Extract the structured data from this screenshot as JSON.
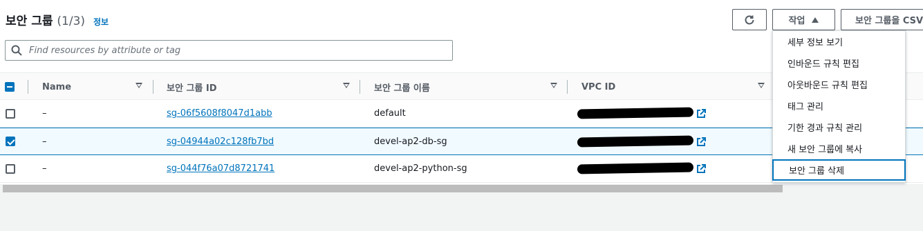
{
  "header": {
    "title": "보안 그룹",
    "count": "(1/3)",
    "info_link": "정보"
  },
  "toolbar": {
    "actions_label": "작업",
    "csv_label": "보안 그룹을 CSV"
  },
  "search": {
    "placeholder": "Find resources by attribute or tag"
  },
  "table": {
    "columns": [
      "Name",
      "보안 그룹 ID",
      "보안 그룹 이름",
      "VPC ID"
    ],
    "rows": [
      {
        "name": "–",
        "group_id": "sg-06f5608f8047d1abb",
        "group_name": "default",
        "selected": false
      },
      {
        "name": "–",
        "group_id": "sg-04944a02c128fb7bd",
        "group_name": "devel-ap2-db-sg",
        "selected": true
      },
      {
        "name": "–",
        "group_id": "sg-044f76a07d8721741",
        "group_name": "devel-ap2-python-sg",
        "selected": false
      }
    ]
  },
  "actions_menu": {
    "items": [
      "세부 정보 보기",
      "인바운드 규칙 편집",
      "아웃바운드 규칙 편집",
      "태그 관리",
      "기한 경과 규칙 관리",
      "새 보안 그룹에 복사",
      "보안 그룹 삭제"
    ],
    "highlighted_index": 6
  },
  "colors": {
    "link": "#0073bb",
    "selected_row_bg": "#f1faff"
  }
}
